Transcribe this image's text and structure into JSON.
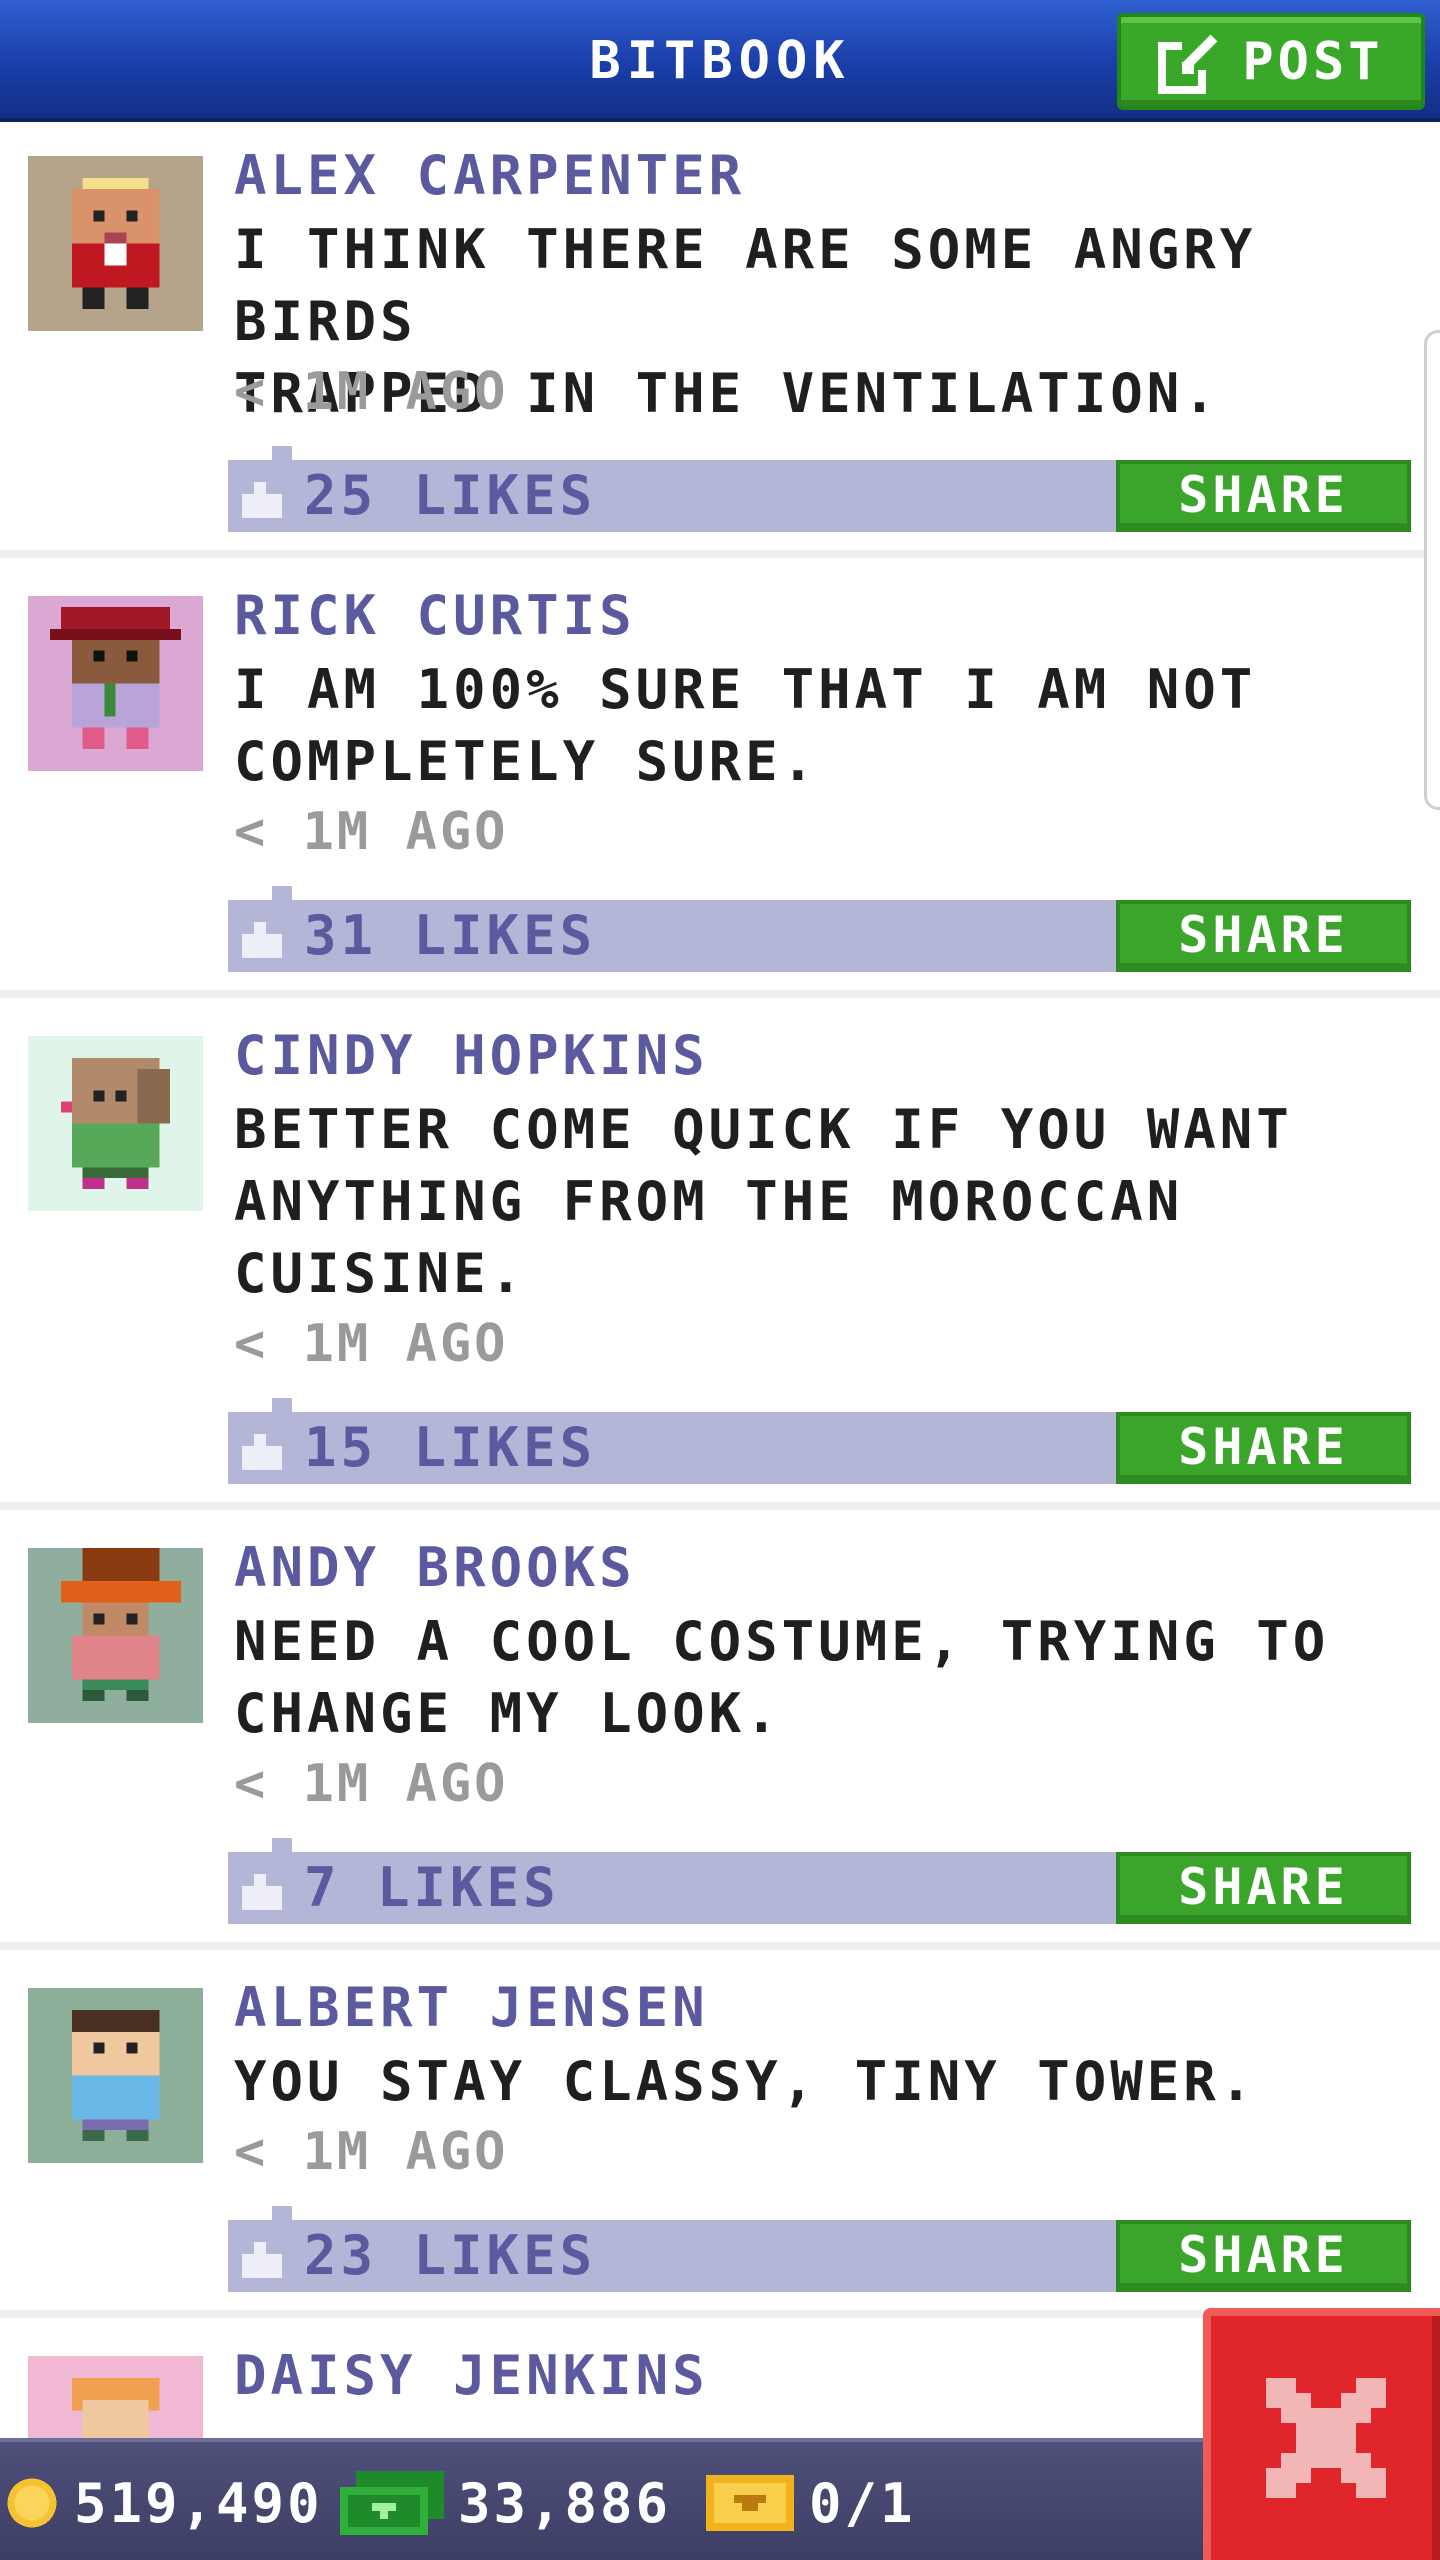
{
  "header": {
    "title": "BITBOOK",
    "post_label": "POST"
  },
  "posts": [
    {
      "name": "ALEX CARPENTER",
      "message": "I THINK THERE ARE SOME ANGRY BIRDS\nTRAPPED IN THE VENTILATION.",
      "time": "< 1M AGO",
      "likes": "25 LIKES",
      "share": "SHARE",
      "avatar_bg": "#b5a48a"
    },
    {
      "name": "RICK CURTIS",
      "message": "I AM 100% SURE THAT I AM NOT\nCOMPLETELY SURE.",
      "time": "< 1M AGO",
      "likes": "31 LIKES",
      "share": "SHARE",
      "avatar_bg": "#dba8d4"
    },
    {
      "name": "CINDY HOPKINS",
      "message": "BETTER COME QUICK IF YOU WANT\nANYTHING FROM THE MOROCCAN\nCUISINE.",
      "time": "< 1M AGO",
      "likes": "15 LIKES",
      "share": "SHARE",
      "avatar_bg": "#dff5ea"
    },
    {
      "name": "ANDY BROOKS",
      "message": "NEED A COOL COSTUME, TRYING TO\nCHANGE MY LOOK.",
      "time": "< 1M AGO",
      "likes": "7 LIKES",
      "share": "SHARE",
      "avatar_bg": "#8fae9e"
    },
    {
      "name": "ALBERT JENSEN",
      "message": "YOU STAY CLASSY, TINY TOWER.",
      "time": "< 1M AGO",
      "likes": "23 LIKES",
      "share": "SHARE",
      "avatar_bg": "#8dae98"
    },
    {
      "name": "DAISY JENKINS",
      "message": "",
      "time": "",
      "likes": "",
      "share": "",
      "avatar_bg": "#f0b8d2"
    }
  ],
  "bottom_bar": {
    "coins": "519,490",
    "bux": "33,886",
    "tickets": "0/1"
  },
  "colors": {
    "header_blue": "#1a3ea8",
    "share_green": "#3aa52a",
    "likes_bar": "#b4b6d8",
    "name_purple": "#5b5a9e",
    "close_red": "#e0262a"
  },
  "icons": {
    "post": "edit-icon",
    "like": "thumbs-up-icon",
    "coin": "coin-icon",
    "bux": "bux-icon",
    "ticket": "ticket-icon",
    "close": "close-icon"
  }
}
